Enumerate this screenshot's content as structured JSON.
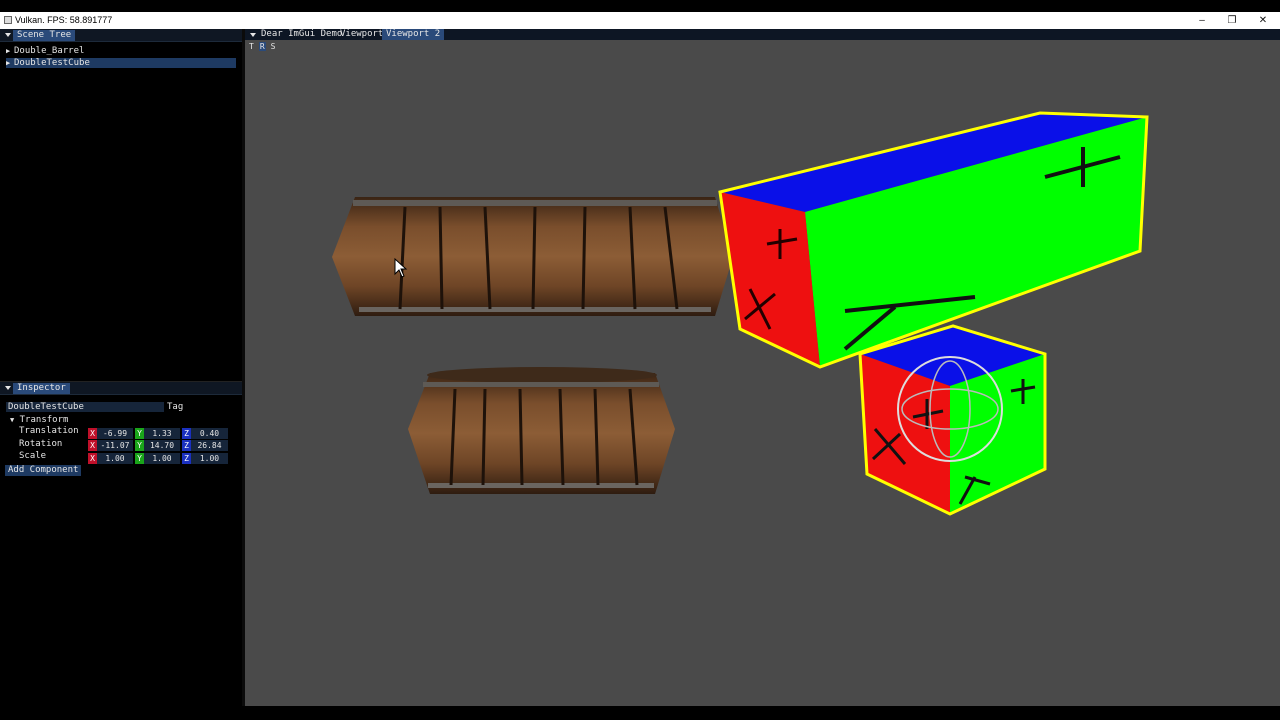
{
  "window": {
    "title": "Vulkan. FPS: 58.891777"
  },
  "scene_tree": {
    "tab": "Scene Tree",
    "items": [
      {
        "label": "Double_Barrel",
        "selected": false
      },
      {
        "label": "DoubleTestCube",
        "selected": true
      }
    ]
  },
  "inspector": {
    "tab": "Inspector",
    "name_value": "DoubleTestCube",
    "tag_label": "Tag",
    "section": "Transform",
    "rows": [
      {
        "label": "Translation",
        "x": "-6.99",
        "y": "1.33",
        "z": "0.40"
      },
      {
        "label": "Rotation",
        "x": "-11.07",
        "y": "14.70",
        "z": "26.84"
      },
      {
        "label": "Scale",
        "x": "1.00",
        "y": "1.00",
        "z": "1.00"
      }
    ],
    "axis_labels": {
      "x": "X",
      "y": "Y",
      "z": "Z"
    },
    "add_component": "Add Component"
  },
  "viewport": {
    "tabs": [
      "Dear ImGui Demo",
      "Viewport",
      "Viewport 2"
    ],
    "active_tab": "Viewport 2",
    "gizmo_modes": [
      "T",
      "R",
      "S"
    ],
    "active_mode": "R",
    "background_color": "#4a4a4a",
    "selection_outline_color": "#ffff00"
  }
}
